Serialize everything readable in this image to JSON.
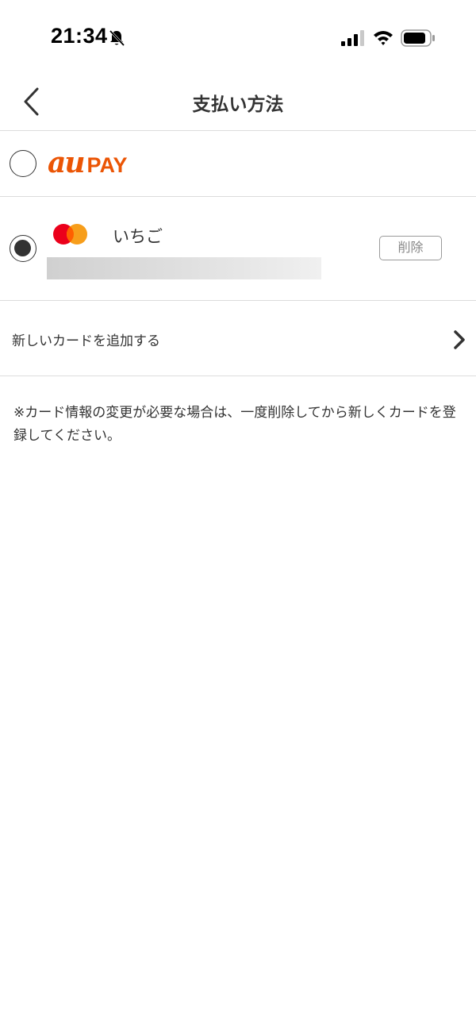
{
  "status_bar": {
    "time": "21:34",
    "icons": [
      "bell-slash-icon",
      "signal-icon",
      "wifi-icon",
      "battery-icon"
    ]
  },
  "header": {
    "title": "支払い方法",
    "back_icon": "chevron-left-icon"
  },
  "payment_methods": [
    {
      "id": "aupay",
      "logo_au": "au",
      "logo_pay": "PAY",
      "brand_color": "#eb5505",
      "selected": false
    },
    {
      "id": "card",
      "brand_icon": "mastercard-icon",
      "nickname": "いちご",
      "delete_label": "削除",
      "selected": true
    }
  ],
  "add_card": {
    "label": "新しいカードを追加する",
    "icon": "chevron-right-icon"
  },
  "notice": "※カード情報の変更が必要な場合は、一度削除してから新しくカードを登録してください。"
}
